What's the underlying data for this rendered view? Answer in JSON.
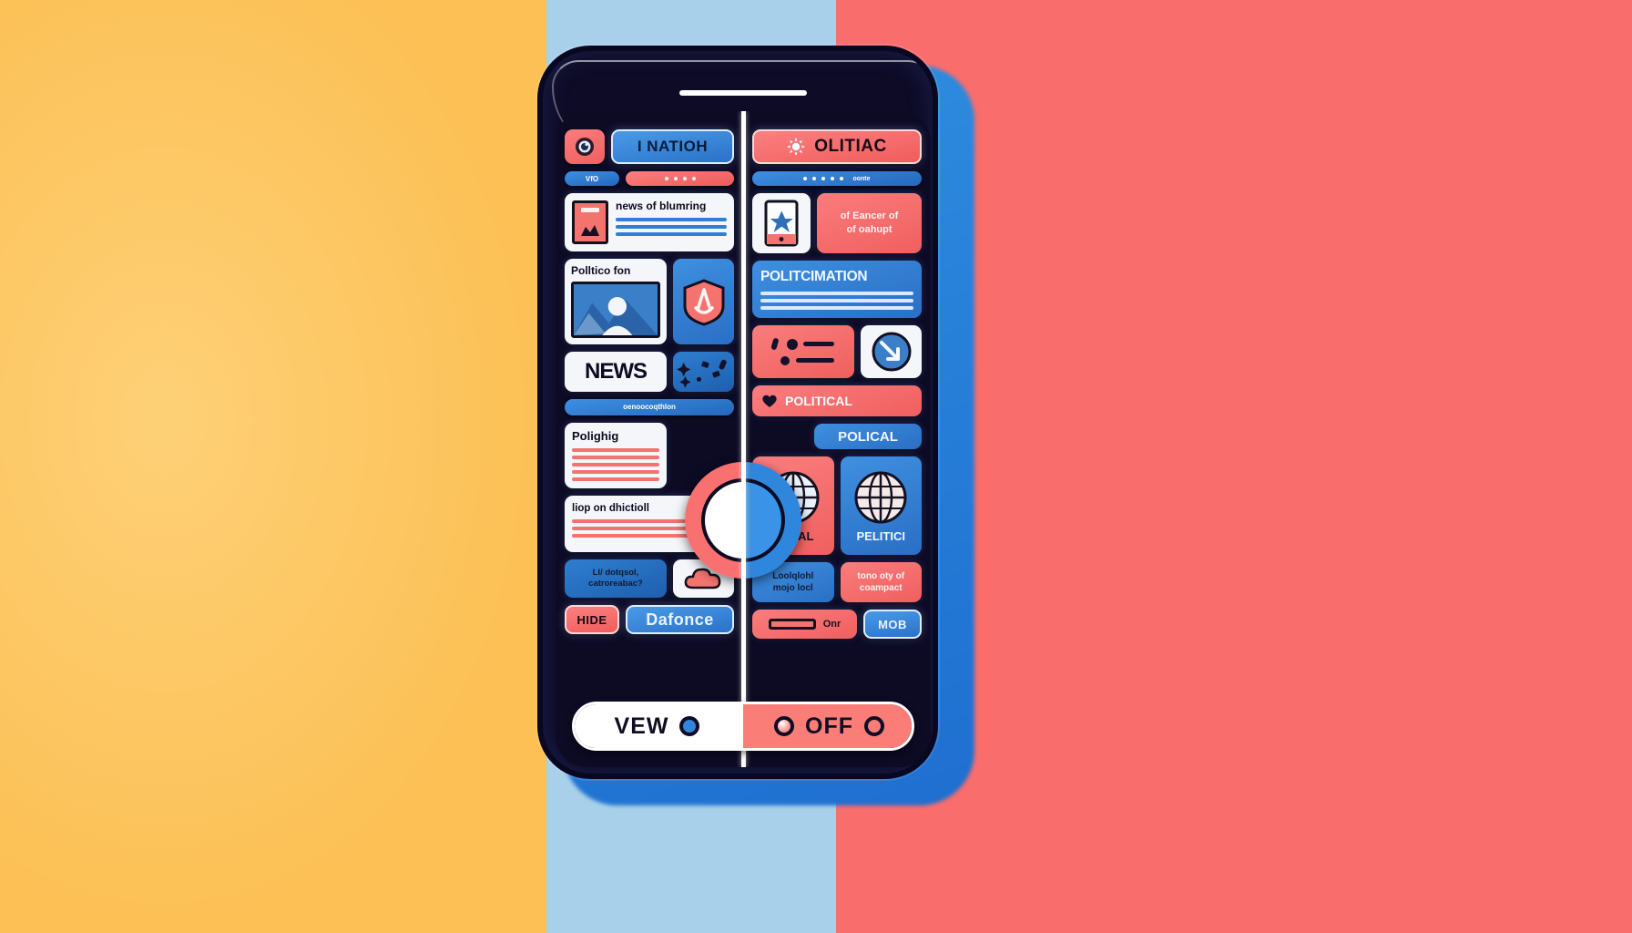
{
  "background": {
    "left_color": "#fcc055",
    "mid_color": "#a9d0ea",
    "right_color": "#fa6d6d"
  },
  "device": {
    "frame_color": "#0e0b26",
    "screen_color": "#0d0a24",
    "speaker_name": "earpiece-speaker"
  },
  "divider": {
    "name": "center-split-divider",
    "color": "#ffffff"
  },
  "left_panel": {
    "accent": "#2f86dd",
    "header": {
      "avatar_icon": "camera-lens-icon",
      "badge_label": "I NATIOH"
    },
    "chip_row": {
      "left_chip_label": "VfO",
      "right_chip_dots": 4
    },
    "article_card": {
      "thumbnail_icon": "document-photo-icon",
      "headline": "news of blumring",
      "line_count": 3
    },
    "feature_card": {
      "headline": "Polltico fon",
      "image_icon": "landscape-person-icon"
    },
    "star_tile": {
      "icon": "star-badge-icon"
    },
    "news_tile": {
      "label": "NEWS"
    },
    "sparkle_tile": {
      "icon": "sparkle-confetti-icon"
    },
    "tag_pill": {
      "label": "oenoocoqthlon"
    },
    "polling_card": {
      "headline": "Polighig",
      "line_count": 5,
      "line_color": "#f4736f"
    },
    "direction_card": {
      "headline": "liop on dhictioll",
      "line_count": 3,
      "thumbnail_icon": "bell-alert-icon"
    },
    "footer_chip": {
      "label_line1": "LI/ dotqsol,",
      "label_line2": "catroreabac?"
    },
    "cloud_tile": {
      "icon": "cloud-icon"
    },
    "hide_button": {
      "label": "HIDE"
    },
    "defence_button": {
      "label": "Dafonce"
    }
  },
  "right_panel": {
    "accent": "#fa6d6d",
    "header": {
      "sun_icon": "sun-burst-icon",
      "badge_label": "OLITIAC"
    },
    "chip_row": {
      "chip_dots": 5,
      "chip_label": "oonte"
    },
    "phone_tile": {
      "icon": "phone-star-icon"
    },
    "note_card": {
      "line1": "of Eancer of",
      "line2": "of oahupt"
    },
    "info_card": {
      "headline": "POLITCIMATION",
      "line_count": 3
    },
    "slider_tile": {
      "icon": "equalizer-sliders-icon"
    },
    "chart_tile": {
      "icon": "down-arrow-chart-icon"
    },
    "political_chip": {
      "icon": "heart-icon",
      "label": "POLITICAL"
    },
    "polical_card": {
      "label": "POLICAL"
    },
    "globe_card_left": {
      "icon": "globe-icon",
      "label": "INITIAL"
    },
    "globe_card_right": {
      "icon": "globe-icon",
      "label": "PELITICI"
    },
    "footer_chip_left": {
      "label_line1": "Loolqlohl",
      "label_line2": "mojo locl"
    },
    "footer_chip_right": {
      "label_line1": "tono oty of",
      "label_line2": "coampact"
    },
    "bar_button": {
      "label": "Onr"
    },
    "mob_button": {
      "label": "MOB"
    }
  },
  "dial": {
    "name": "split-mode-dial",
    "left_color": "#f87070",
    "right_color": "#2f86dd"
  },
  "toggle_bar": {
    "left_label": "VEW",
    "right_label": "OFF",
    "left_radio_color": "#2f86dd",
    "right_radio_color": "#f9a0a0"
  }
}
